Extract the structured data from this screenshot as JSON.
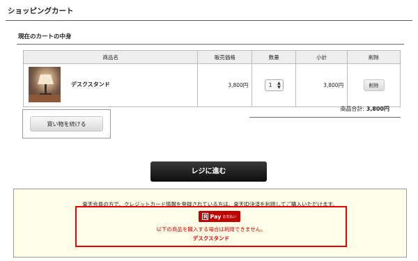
{
  "page": {
    "title": "ショッピングカート"
  },
  "cart": {
    "section_title": "現在のカートの中身",
    "columns": {
      "name": "商品名",
      "price": "販売価格",
      "qty": "数量",
      "subtotal": "小計",
      "delete": "削除"
    },
    "items": [
      {
        "name": "デスクスタンド",
        "price": "3,800円",
        "qty": "1",
        "subtotal": "3,800円",
        "delete_label": "削除",
        "image_icon": "desk-lamp-photo"
      }
    ],
    "total_label": "商品合計:",
    "total_value": "3,800円"
  },
  "actions": {
    "continue_label": "買い物を続ける",
    "checkout_label": "レジに進む"
  },
  "notice": {
    "text": "楽天会員の方で、クレジットカード情報を登録されている方は、楽天ID決済を利用してご購入いただけます。",
    "rpay": {
      "r_mark": "R",
      "pay": "Pay",
      "sub": "お支払い",
      "warning": "以下の商品を購入する場合は利用できません。",
      "item": "デスクスタンド"
    },
    "colors": {
      "accent": "#e60000",
      "badge": "#bf0000"
    }
  }
}
